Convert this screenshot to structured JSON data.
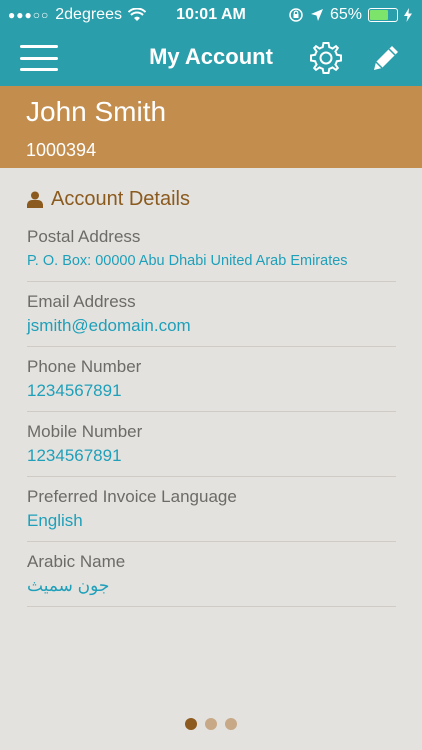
{
  "status": {
    "carrier": "2degrees",
    "time": "10:01 AM",
    "battery": "65%",
    "battery_level": 0.65
  },
  "nav": {
    "title": "My Account"
  },
  "profile": {
    "name": "John Smith",
    "account_number": "1000394"
  },
  "account": {
    "section_title": "Account Details",
    "fields": [
      {
        "label": "Postal Address",
        "value": "P. O. Box: 00000 Abu Dhabi United Arab Emirates"
      },
      {
        "label": "Email Address",
        "value": "jsmith@edomain.com"
      },
      {
        "label": "Phone Number",
        "value": "1234567891"
      },
      {
        "label": "Mobile Number",
        "value": "1234567891"
      },
      {
        "label": "Preferred Invoice Language",
        "value": "English"
      },
      {
        "label": "Arabic Name",
        "value": "جون سميث"
      }
    ]
  },
  "pager": {
    "count": 3,
    "active": 0
  },
  "colors": {
    "header": "#2a9eab",
    "profile_band": "#c38d4d",
    "background": "#e4e2de",
    "accent_text": "#1fa0ba",
    "section_title": "#8a5a1e"
  }
}
